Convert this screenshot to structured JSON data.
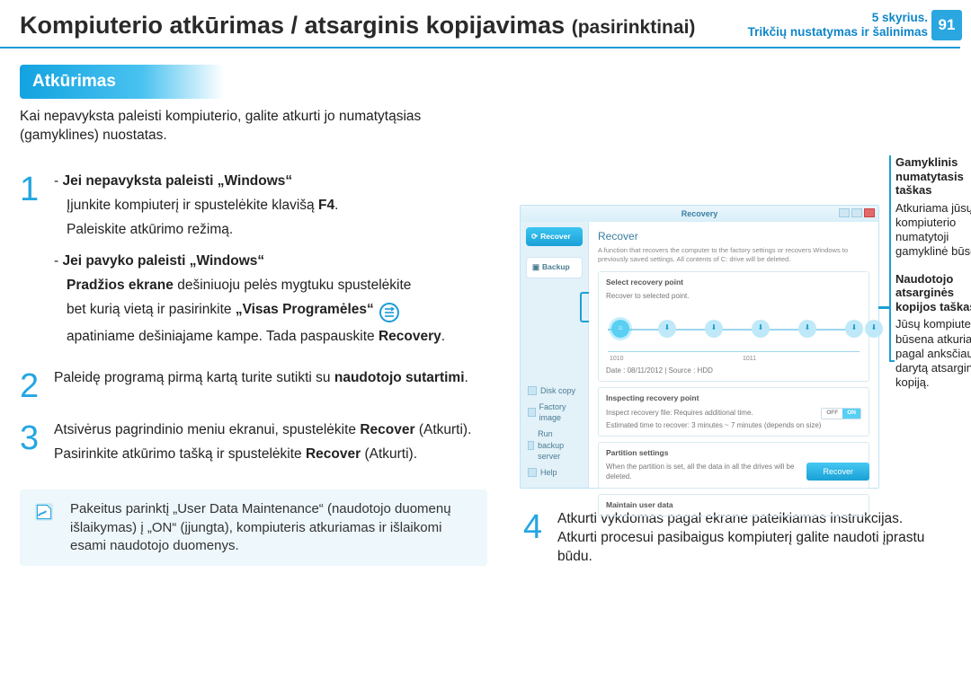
{
  "header": {
    "title_main": "Kompiuterio atkūrimas / atsarginis kopijavimas ",
    "title_sub": "(pasirinktinai)",
    "chapter_line1": "5 skyrius.",
    "chapter_line2": "Trikčių nustatymas ir šalinimas",
    "page": "91"
  },
  "section_label": "Atkūrimas",
  "intro": "Kai nepavyksta paleisti kompiuterio, galite atkurti jo numatytąsias (gamyklines) nuostatas.",
  "step1": {
    "bullet_a_head": "Jei nepavyksta paleisti „Windows“",
    "bullet_a_line1_pre": "Įjunkite kompiuterį ir spustelėkite klavišą ",
    "bullet_a_line1_key": "F4",
    "bullet_a_line1_post": ".",
    "bullet_a_line2": "Paleiskite atkūrimo režimą.",
    "bullet_b_head": "Jei pavyko paleisti „Windows“",
    "bullet_b_line1_pre": "Pradžios ekrane",
    "bullet_b_line1_post": " dešiniuoju pelės mygtuku spustelėkite",
    "bullet_b_line2_pre": "bet kurią vietą ir pasirinkite ",
    "bullet_b_line2_strong": "„Visas Programėles“",
    "bullet_b_line3_pre": "apatiniame dešiniajame kampe. Tada paspauskite ",
    "bullet_b_line3_strong": "Recovery",
    "bullet_b_line3_post": "."
  },
  "step2": {
    "pre": "Paleidę programą pirmą kartą turite sutikti su ",
    "strong": "naudotojo sutartimi",
    "post": "."
  },
  "step3": {
    "line1_pre": "Atsivėrus pagrindinio meniu ekranui, spustelėkite ",
    "line1_strong": "Recover",
    "line1_post": " (Atkurti).",
    "line2_pre": "Pasirinkite atkūrimo tašką ir spustelėkite ",
    "line2_strong": "Recover",
    "line2_post": " (Atkurti)."
  },
  "note": "Pakeitus parinktį „User Data Maintenance“ (naudotojo duomenų išlaikymas) į „ON“ (įjungta), kompiuteris atkuriamas ir išlaikomi esami naudotojo duomenys.",
  "step4": {
    "line1": "Atkurti vykdomas pagal ekrane pateikiamas instrukcijas.",
    "line2": "Atkurti procesui pasibaigus kompiuterį galite naudoti įprastu būdu."
  },
  "legend": {
    "factory_title": "Gamyklinis numatytasis taškas",
    "factory_body": "Atkuriama jūsų kompiuterio numatytoji gamyklinė būsena.",
    "user_title": "Naudotojo atsarginės kopijos taškas",
    "user_body": "Jūsų kompiuterio būsena atkuriama pagal anksčiau darytą atsarginę kopiją."
  },
  "app": {
    "title": "Recovery",
    "side_recover": "Recover",
    "side_backup": "Backup",
    "side_links": [
      "Disk copy",
      "Factory image",
      "Run backup server",
      "Help"
    ],
    "main_heading": "Recover",
    "main_desc": "A function that recovers the computer to the factory settings or recovers Windows to previously saved settings. All contents of C: drive will be deleted.",
    "panel1_title": "Select recovery point",
    "panel1_sub": "Recover to selected point.",
    "timeline_left": "1010",
    "timeline_right": "1011",
    "meta": "Date : 08/11/2012 | Source : HDD",
    "panel2_title": "Inspecting recovery point",
    "panel2_row1": "Inspect recovery file: Requires additional time.",
    "panel2_row2": "Estimated time to recover: 3 minutes ~ 7 minutes (depends on size)",
    "panel3_title": "Partition settings",
    "panel3_row": "When the partition is set, all the data in all the drives will be deleted.",
    "panel4_title": "Maintain user data",
    "off": "OFF",
    "on": "ON",
    "recover_btn": "Recover"
  }
}
